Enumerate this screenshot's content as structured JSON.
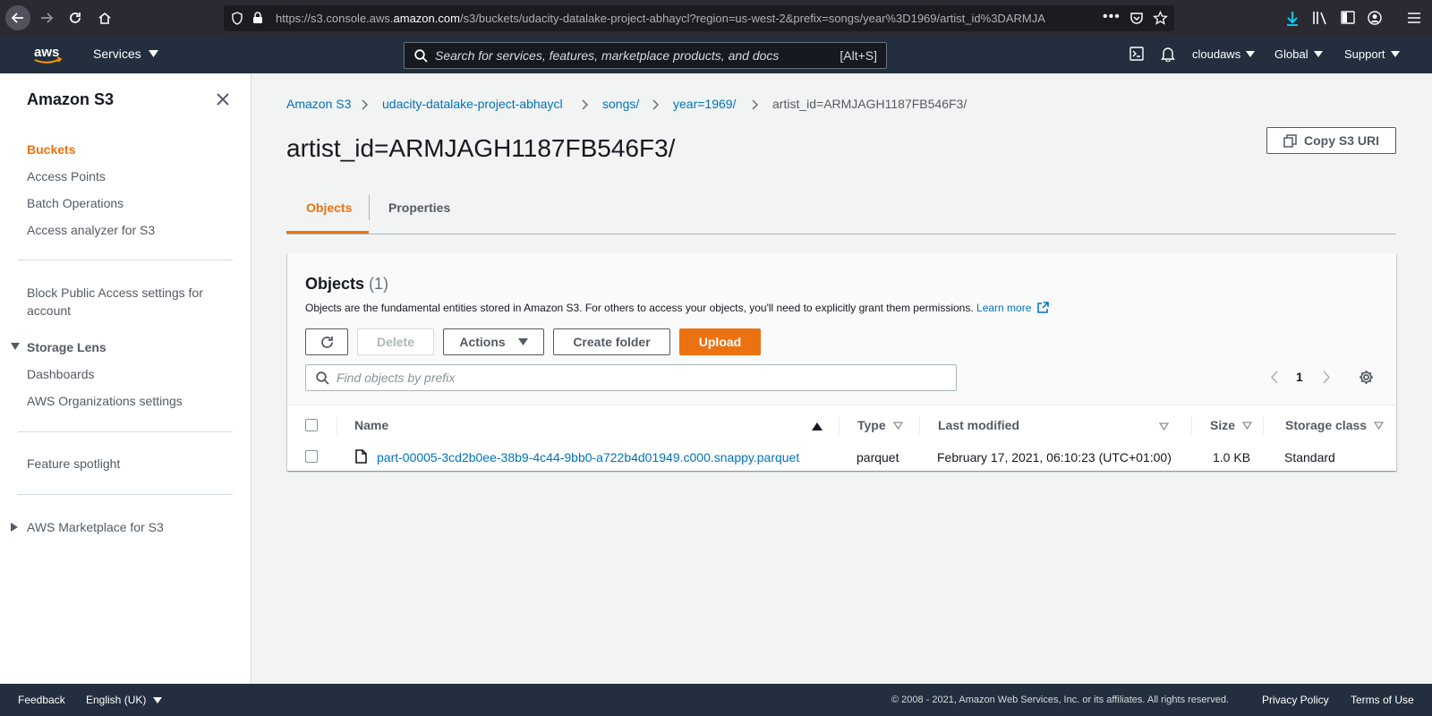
{
  "browser": {
    "url_prefix": "https://s3.console.aws.",
    "url_domain": "amazon.com",
    "url_path": "/s3/buckets/udacity-datalake-project-abhaycl?region=us-west-2&prefix=songs/year%3D1969/artist_id%3DARMJA"
  },
  "topnav": {
    "services_label": "Services",
    "search_placeholder": "Search for services, features, marketplace products, and docs",
    "search_shortcut": "[Alt+S]",
    "account_label": "cloudaws",
    "region_label": "Global",
    "support_label": "Support"
  },
  "sidebar": {
    "title": "Amazon S3",
    "items": {
      "buckets": "Buckets",
      "access_points": "Access Points",
      "batch_operations": "Batch Operations",
      "access_analyzer": "Access analyzer for S3",
      "block_public_access_1": "Block Public Access settings for",
      "block_public_access_2": "account",
      "storage_lens": "Storage Lens",
      "dashboards": "Dashboards",
      "aws_org_settings": "AWS Organizations settings",
      "feature_spotlight": "Feature spotlight",
      "marketplace": "AWS Marketplace for S3"
    }
  },
  "breadcrumb": {
    "items": [
      "Amazon S3",
      "udacity-datalake-project-abhaycl",
      "songs/",
      "year=1969/",
      "artist_id=ARMJAGH1187FB546F3/"
    ]
  },
  "page": {
    "title": "artist_id=ARMJAGH1187FB546F3/",
    "copy_uri_label": "Copy S3 URI",
    "tabs": [
      "Objects",
      "Properties"
    ]
  },
  "objects_panel": {
    "heading": "Objects",
    "count": "(1)",
    "description": "Objects are the fundamental entities stored in Amazon S3. For others to access your objects, you'll need to explicitly grant them permissions.",
    "learn_more": "Learn more",
    "buttons": {
      "delete": "Delete",
      "actions": "Actions",
      "create_folder": "Create folder",
      "upload": "Upload"
    },
    "find_placeholder": "Find objects by prefix",
    "page_number": "1",
    "columns": [
      "Name",
      "Type",
      "Last modified",
      "Size",
      "Storage class"
    ],
    "rows": [
      {
        "name": "part-00005-3cd2b0ee-38b9-4c44-9bb0-a722b4d01949.c000.snappy.parquet",
        "type": "parquet",
        "last_modified": "February 17, 2021, 06:10:23 (UTC+01:00)",
        "size": "1.0 KB",
        "storage_class": "Standard"
      }
    ]
  },
  "footer": {
    "feedback": "Feedback",
    "language": "English (UK)",
    "copyright": "© 2008 - 2021, Amazon Web Services, Inc. or its affiliates. All rights reserved.",
    "privacy": "Privacy Policy",
    "terms": "Terms of Use"
  },
  "colors": {
    "aws_nav": "#232f3e",
    "accent_orange": "#ec7211",
    "link_blue": "#0073bb",
    "browser_chrome": "#2b2a33"
  }
}
